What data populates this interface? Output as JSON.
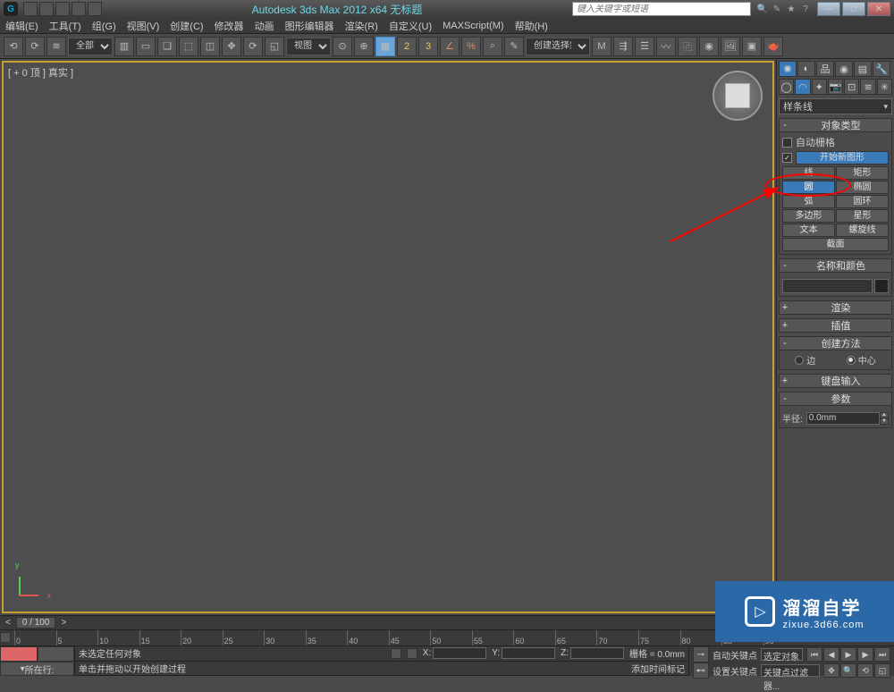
{
  "title": "Autodesk 3ds Max 2012 x64   无标题",
  "search_placeholder": "键入关键字或短语",
  "menus": [
    "编辑(E)",
    "工具(T)",
    "组(G)",
    "视图(V)",
    "创建(C)",
    "修改器",
    "动画",
    "图形编辑器",
    "渲染(R)",
    "自定义(U)",
    "MAXScript(M)",
    "帮助(H)"
  ],
  "toolbar_scope": "全部",
  "toolbar_view": "视图",
  "toolbar_selset": "创建选择集",
  "viewport_label": "[ + 0 顶 ] 真实 ]",
  "axis": {
    "x": "x",
    "y": "y"
  },
  "cmd": {
    "category": "样条线",
    "rollouts": {
      "objtype": {
        "title": "对象类型",
        "autogrid": "自动栅格",
        "newshape": "开始新图形"
      },
      "shapes": [
        [
          "线",
          "矩形"
        ],
        [
          "圆",
          "椭圆"
        ],
        [
          "弧",
          "圆环"
        ],
        [
          "多边形",
          "星形"
        ],
        [
          "文本",
          "螺旋线"
        ],
        [
          "截面",
          ""
        ]
      ],
      "namecolor": "名称和颜色",
      "render": "渲染",
      "interp": "插值",
      "method": {
        "title": "创建方法",
        "edge": "边",
        "center": "中心"
      },
      "keyboard": "键盘输入",
      "params": {
        "title": "参数",
        "radius_label": "半径:",
        "radius_value": "0.0mm"
      }
    }
  },
  "timeline": {
    "label": "0 / 100",
    "ticks": [
      "0",
      "5",
      "10",
      "15",
      "20",
      "25",
      "30",
      "35",
      "40",
      "45",
      "50",
      "55",
      "60",
      "65",
      "70",
      "75",
      "80",
      "85",
      "90"
    ]
  },
  "status": {
    "none_selected": "未选定任何对象",
    "prompt": "单击并拖动以开始创建过程",
    "add_marker": "添加时间标记",
    "grid": "栅格 = 0.0mm",
    "autokey": "自动关键点",
    "setkey": "设置关键点",
    "selset": "选定对象",
    "keyfilter": "关键点过滤器...",
    "line_label": "所在行:",
    "x": "X:",
    "y": "Y:",
    "z": "Z:"
  },
  "watermark": {
    "big": "溜溜自学",
    "small": "zixue.3d66.com"
  }
}
